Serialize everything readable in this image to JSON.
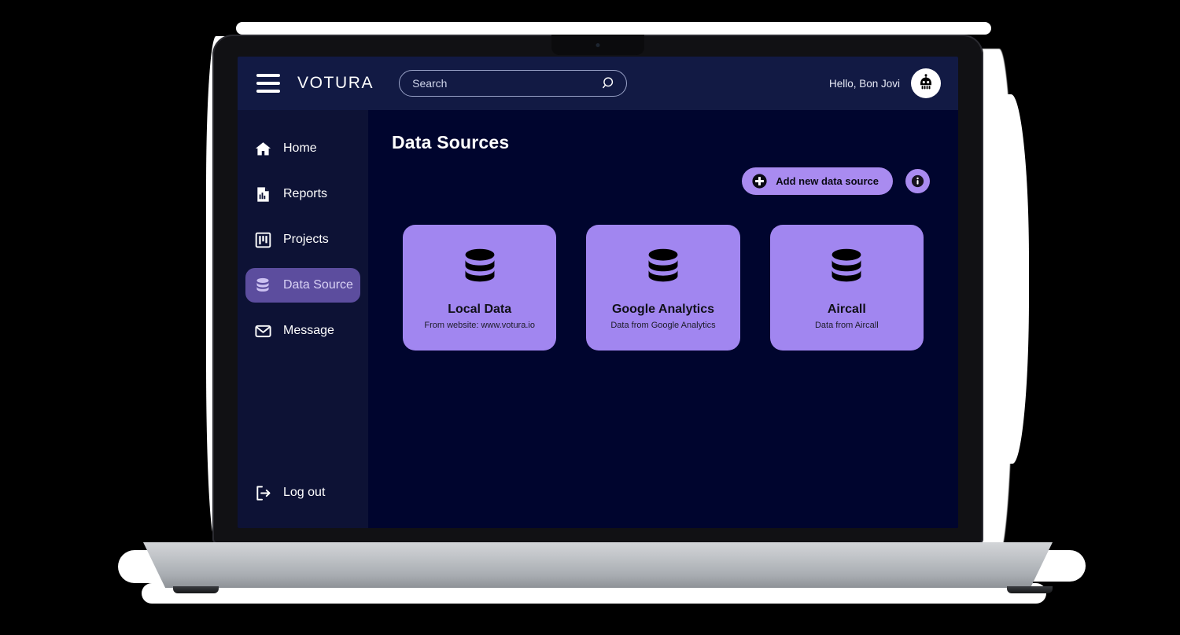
{
  "header": {
    "menu_icon": "hamburger-menu-icon",
    "brand": "VOTURA",
    "search": {
      "value": "",
      "placeholder": "Search",
      "icon": "search-icon"
    },
    "greeting": "Hello, Bon Jovi",
    "avatar_icon": "robot-avatar-icon"
  },
  "sidebar": {
    "items": [
      {
        "label": "Home",
        "icon": "home-icon",
        "active": false
      },
      {
        "label": "Reports",
        "icon": "report-document-icon",
        "active": false
      },
      {
        "label": "Projects",
        "icon": "kanban-board-icon",
        "active": false
      },
      {
        "label": "Data Source",
        "icon": "database-icon",
        "active": true
      },
      {
        "label": "Message",
        "icon": "envelope-icon",
        "active": false
      }
    ],
    "logout": {
      "label": "Log out",
      "icon": "logout-arrow-icon"
    }
  },
  "main": {
    "title": "Data Sources",
    "add_button": {
      "label": "Add new data source",
      "icon": "plus-circle-icon"
    },
    "info_button": {
      "icon": "info-circle-icon",
      "label": "i"
    },
    "cards": [
      {
        "title": "Local Data",
        "subtitle": "From website: www.votura.io",
        "icon": "database-icon"
      },
      {
        "title": "Google Analytics",
        "subtitle": "Data from Google Analytics",
        "icon": "database-icon"
      },
      {
        "title": "Aircall",
        "subtitle": "Data from Aircall",
        "icon": "database-icon"
      }
    ]
  },
  "colors": {
    "accent_purple": "#a186f0",
    "button_purple": "#a98bf0",
    "active_nav": "#5c4d9e",
    "header_navy": "#121a44",
    "sidebar_navy": "#0d1235",
    "content_navy": "#00052e"
  }
}
